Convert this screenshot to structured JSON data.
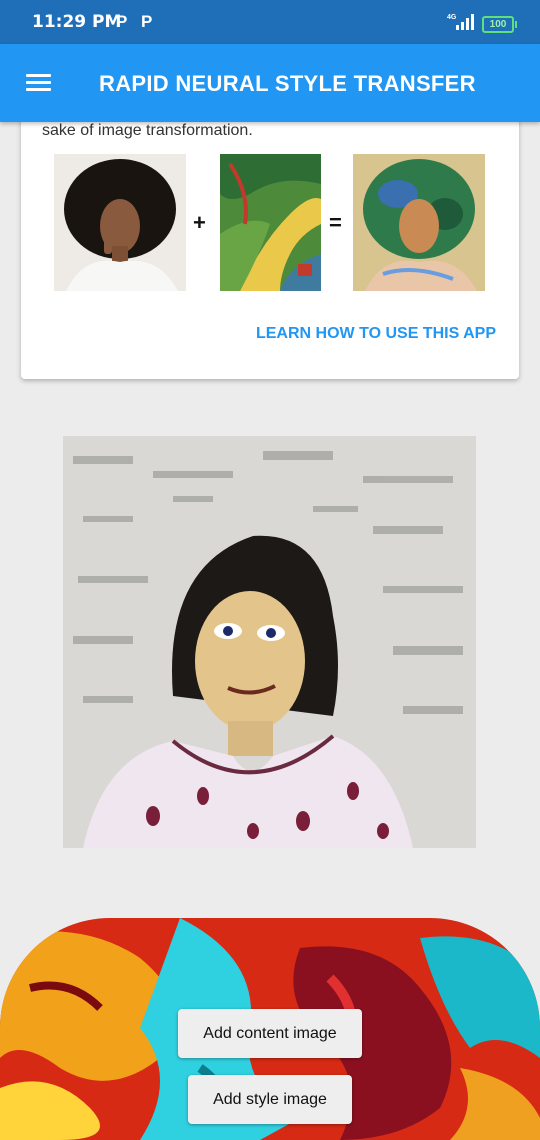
{
  "status_bar": {
    "time": "11:29 PM",
    "notification_icons": [
      "P",
      "P"
    ],
    "network": "4G",
    "battery": "100"
  },
  "app_bar": {
    "menu_icon": "hamburger-menu-icon",
    "title": "RAPID NEURAL STYLE TRANSFER"
  },
  "info_card": {
    "text": "sake of image transformation.",
    "example": {
      "content_image": "portrait-photo",
      "plus_symbol": "+",
      "style_image": "painting",
      "equals_symbol": "=",
      "result_image": "stylized-portrait"
    },
    "link_label": "LEARN HOW TO USE THIS APP"
  },
  "result": {
    "image": "stylized-result-photo"
  },
  "actions": {
    "add_content_label": "Add content image",
    "add_style_label": "Add style image"
  },
  "colors": {
    "status_bar": "#1e6fb8",
    "app_bar": "#2196f3",
    "link": "#2196f3",
    "background": "#ececec"
  }
}
